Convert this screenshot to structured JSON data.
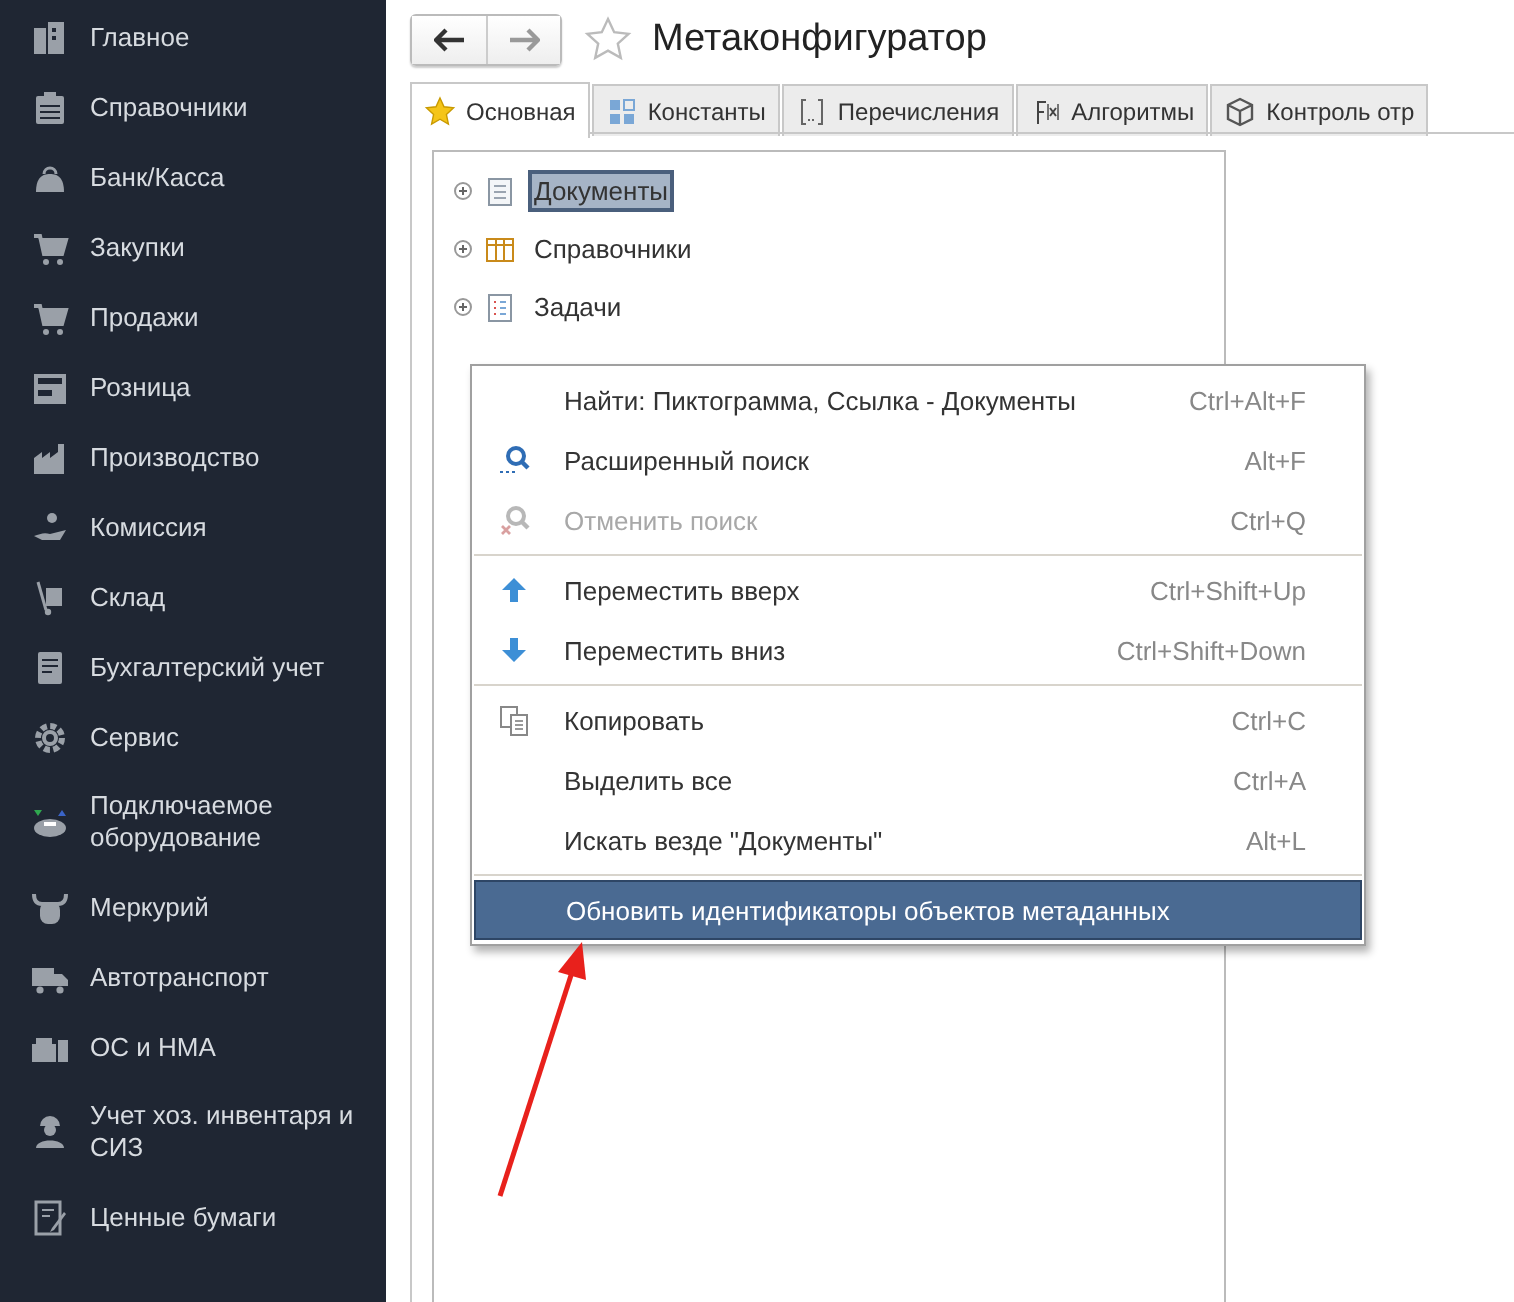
{
  "sidebar": {
    "items": [
      {
        "label": "Главное",
        "selected": false
      },
      {
        "label": "Справочники",
        "selected": false
      },
      {
        "label": "Банк/Касса",
        "selected": false
      },
      {
        "label": "Закупки",
        "selected": false
      },
      {
        "label": "Продажи",
        "selected": false
      },
      {
        "label": "Розница",
        "selected": false
      },
      {
        "label": "Производство",
        "selected": false
      },
      {
        "label": "Комиссия",
        "selected": false
      },
      {
        "label": "Склад",
        "selected": false
      },
      {
        "label": "Бухгалтерский учет",
        "selected": false
      },
      {
        "label": "Сервис",
        "selected": false
      },
      {
        "label": "Подключаемое оборудование",
        "selected": false
      },
      {
        "label": "Меркурий",
        "selected": false
      },
      {
        "label": "Автотранспорт",
        "selected": false
      },
      {
        "label": "ОС и НМА",
        "selected": false
      },
      {
        "label": "Учет хоз. инвентаря и СИЗ",
        "selected": false
      },
      {
        "label": "Ценные бумаги",
        "selected": false
      }
    ]
  },
  "window": {
    "title": "Метаконфигуратор",
    "favorite": false
  },
  "tabs": [
    {
      "label": "Основная",
      "kind": "star",
      "selected": true
    },
    {
      "label": "Константы",
      "kind": "blocks",
      "selected": false
    },
    {
      "label": "Перечисления",
      "kind": "braces",
      "selected": false
    },
    {
      "label": "Алгоритмы",
      "kind": "function",
      "selected": false
    },
    {
      "label": "Контроль отр",
      "kind": "cube",
      "selected": false
    }
  ],
  "tree": {
    "items": [
      {
        "label": "Документы",
        "kind": "document",
        "expanded": false,
        "selected": true
      },
      {
        "label": "Справочники",
        "kind": "table",
        "expanded": false,
        "selected": false
      },
      {
        "label": "Задачи",
        "kind": "tasks",
        "expanded": false,
        "selected": false
      }
    ]
  },
  "context_menu": {
    "groups": [
      [
        {
          "label": "Найти: Пиктограмма, Ссылка - Документы",
          "shortcut": "Ctrl+Alt+F",
          "kind": "plain",
          "disabled": false,
          "selected": false
        },
        {
          "label": "Расширенный поиск",
          "shortcut": "Alt+F",
          "kind": "search",
          "disabled": false,
          "selected": false
        },
        {
          "label": "Отменить поиск",
          "shortcut": "Ctrl+Q",
          "kind": "cancel-search",
          "disabled": true,
          "selected": false
        }
      ],
      [
        {
          "label": "Переместить вверх",
          "shortcut": "Ctrl+Shift+Up",
          "kind": "up",
          "disabled": false,
          "selected": false
        },
        {
          "label": "Переместить вниз",
          "shortcut": "Ctrl+Shift+Down",
          "kind": "down",
          "disabled": false,
          "selected": false
        }
      ],
      [
        {
          "label": "Копировать",
          "shortcut": "Ctrl+C",
          "kind": "copy",
          "disabled": false,
          "selected": false
        },
        {
          "label": "Выделить все",
          "shortcut": "Ctrl+A",
          "kind": "plain",
          "disabled": false,
          "selected": false
        },
        {
          "label": "Искать везде \"Документы\"",
          "shortcut": "Alt+L",
          "kind": "plain",
          "disabled": false,
          "selected": false
        }
      ],
      [
        {
          "label": "Обновить идентификаторы объектов метаданных",
          "kind": "plain",
          "disabled": false,
          "selected": true
        }
      ]
    ]
  }
}
